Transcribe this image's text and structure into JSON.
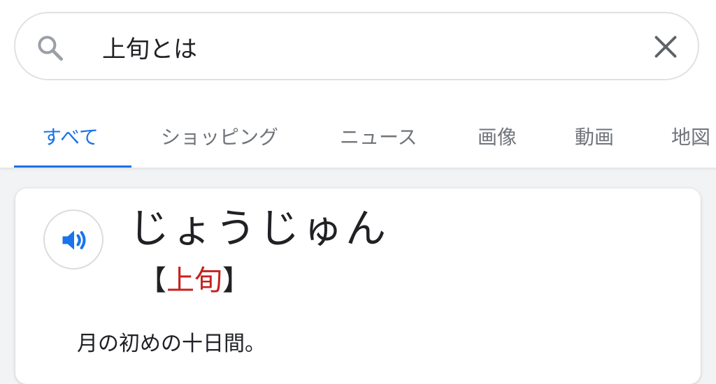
{
  "search": {
    "query": "上旬とは"
  },
  "tabs": [
    {
      "label": "すべて",
      "active": true
    },
    {
      "label": "ショッピング",
      "active": false
    },
    {
      "label": "ニュース",
      "active": false
    },
    {
      "label": "画像",
      "active": false
    },
    {
      "label": "動画",
      "active": false
    },
    {
      "label": "地図",
      "active": false
    }
  ],
  "dictionary": {
    "reading": "じょうじゅん",
    "bracket_open": "【",
    "kanji": "上旬",
    "bracket_close": "】",
    "definition": "月の初めの十日間。"
  },
  "icons": {
    "search": "search-icon",
    "clear": "close-icon",
    "audio": "speaker-icon"
  },
  "colors": {
    "accent": "#1a73e8",
    "kanji": "#c5221f",
    "text": "#202124",
    "muted": "#70757a"
  }
}
